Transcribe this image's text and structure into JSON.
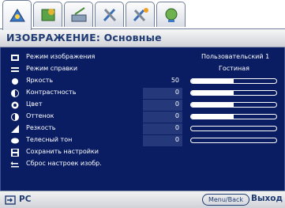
{
  "header": {
    "title": "ИЗОБРАЖЕНИЕ: Основные"
  },
  "tabs": [
    {
      "icon": "picture-icon",
      "active": true
    },
    {
      "icon": "advanced-picture-icon",
      "active": false
    },
    {
      "icon": "display-icon",
      "active": false
    },
    {
      "icon": "settings-icon",
      "active": false
    },
    {
      "icon": "advanced-settings-icon",
      "active": false
    },
    {
      "icon": "information-icon",
      "active": false
    }
  ],
  "menu": {
    "picture_mode": {
      "label": "Режим изображения",
      "value": "Пользовательский 1"
    },
    "reference_mode": {
      "label": "Режим справки",
      "value": "Гостиная"
    },
    "brightness": {
      "label": "Яркость",
      "value": "50",
      "level": 0.5
    },
    "contrast": {
      "label": "Контрастность",
      "value": "0",
      "level": 0.5
    },
    "color": {
      "label": "Цвет",
      "value": "0",
      "level": 0.5
    },
    "tint": {
      "label": "Оттенок",
      "value": "0",
      "level": 0.5
    },
    "sharpness": {
      "label": "Резкость",
      "value": "0",
      "level": 0.0
    },
    "skin_tone": {
      "label": "Телесный тон",
      "value": "0",
      "level": 0.0
    },
    "save_settings": {
      "label": "Сохранить настройки"
    },
    "reset_settings": {
      "label": "Сброс настроек изобр."
    }
  },
  "footer": {
    "source_label": "PC",
    "menu_back_label": "Menu/Back",
    "exit_label": "Выход"
  }
}
